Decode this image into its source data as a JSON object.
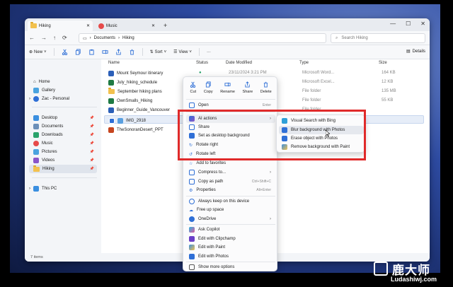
{
  "window": {
    "tabs": [
      {
        "label": "Hiking"
      },
      {
        "label": "Music"
      }
    ],
    "nav": {
      "back": "←",
      "forward": "→",
      "up": "↑",
      "refresh": "⟳"
    },
    "breadcrumb": [
      "Documents",
      "Hiking"
    ],
    "search_placeholder": "Search Hiking",
    "toolbar": {
      "new": "New",
      "sort": "Sort",
      "view": "View",
      "more": "···",
      "details": "Details"
    }
  },
  "sidebar": {
    "items": [
      {
        "label": "Home"
      },
      {
        "label": "Gallery"
      },
      {
        "label": "Zac - Personal"
      },
      {
        "label": "Desktop"
      },
      {
        "label": "Documents"
      },
      {
        "label": "Downloads"
      },
      {
        "label": "Music"
      },
      {
        "label": "Pictures"
      },
      {
        "label": "Videos"
      },
      {
        "label": "Hiking"
      },
      {
        "label": "This PC"
      }
    ]
  },
  "columns": {
    "name": "Name",
    "status": "Status",
    "date": "Date Modified",
    "type": "Type",
    "size": "Size"
  },
  "files": [
    {
      "name": "Mount Seymour itinerary",
      "date": "23/11/2024 3:21 PM",
      "type": "Microsoft Word...",
      "size": "164 KB"
    },
    {
      "name": "July_hiking_schedule",
      "date": "",
      "type": "Microsoft Excel...",
      "size": "12 KB"
    },
    {
      "name": "September hiking plans",
      "date": "",
      "type": "File folder",
      "size": "135 MB"
    },
    {
      "name": "OwnSmalls_Hiking",
      "date": "",
      "type": "File folder",
      "size": "55 KB"
    },
    {
      "name": "Beginner_Guide_Vancouver",
      "date": "",
      "type": "File folder",
      "size": ""
    },
    {
      "name": "IMG_2918",
      "date": "",
      "type": "",
      "size": ""
    },
    {
      "name": "TheSonoranDesert_PPT",
      "date": "",
      "type": "",
      "size": ""
    }
  ],
  "status_bar": "7 items",
  "context_menu": {
    "quick": [
      {
        "label": "Cut"
      },
      {
        "label": "Copy"
      },
      {
        "label": "Rename"
      },
      {
        "label": "Share"
      },
      {
        "label": "Delete"
      }
    ],
    "items": [
      {
        "label": "Open",
        "shortcut": "Enter"
      },
      {
        "label": "AI actions",
        "arrow": "›"
      },
      {
        "label": "Share"
      },
      {
        "label": "Set as desktop background"
      },
      {
        "label": "Rotate right"
      },
      {
        "label": "Rotate left"
      },
      {
        "label": "Add to favorites"
      },
      {
        "label": "Compress to...",
        "arrow": "›"
      },
      {
        "label": "Copy as path",
        "shortcut": "Ctrl+Shift+C"
      },
      {
        "label": "Properties",
        "shortcut": "Alt+Enter"
      },
      {
        "label": "Always keep on this device"
      },
      {
        "label": "Free up space"
      },
      {
        "label": "OneDrive",
        "arrow": "›"
      },
      {
        "label": "Ask Copilot"
      },
      {
        "label": "Edit with Clipchamp"
      },
      {
        "label": "Edit with Paint"
      },
      {
        "label": "Edit with Photos"
      },
      {
        "label": "Show more options"
      }
    ]
  },
  "submenu": {
    "items": [
      {
        "label": "Visual Search with Bing"
      },
      {
        "label": "Blur background with Photos"
      },
      {
        "label": "Erase object with Photos"
      },
      {
        "label": "Remove background with Paint"
      }
    ]
  },
  "watermark": {
    "cn": "鹿大师",
    "en": "Ludashiwj.com"
  },
  "colors": {
    "highlight_box": "#e02a2a",
    "accent": "#2f6fd6",
    "folder": "#f2c14e"
  }
}
